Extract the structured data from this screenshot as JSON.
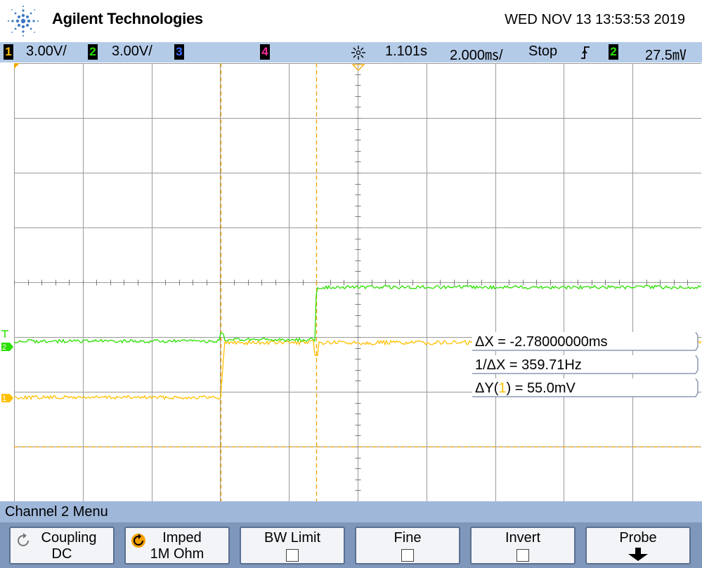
{
  "header": {
    "brand": "Agilent Technologies",
    "datetime": "WED NOV 13 13:53:53 2019"
  },
  "status_bar": {
    "ch1_number": "1",
    "ch1_scale": "3.00V/",
    "ch2_number": "2",
    "ch2_scale": "3.00V/",
    "ch3_number": "3",
    "ch4_number": "4",
    "time_delay": "1.101s",
    "time_scale": "2.000㎳/",
    "run_state": "Stop",
    "trigger_source": "2",
    "trigger_level": "27.5㎷"
  },
  "waveform": {
    "channel1_color": "#ffc000",
    "channel2_color": "#2ae000",
    "channel1_marker": "1",
    "channel2_marker": "2",
    "trigger_marker": "T"
  },
  "measurements": {
    "delta_x": "ΔX = -2.78000000ms",
    "inv_delta_x": "1/ΔX = 359.71Hz",
    "delta_y_prefix": "ΔY(",
    "delta_y_channel": "1",
    "delta_y_suffix": ") = 55.0mV"
  },
  "menu": {
    "title": "Channel 2  Menu",
    "softkeys": [
      {
        "line1": "Coupling",
        "line2": "DC",
        "icon": "rotate-arrow-icon"
      },
      {
        "line1": "Imped",
        "line2": "1M Ohm",
        "icon": "rotate-arrow-icon"
      },
      {
        "line1": "BW Limit",
        "checked": false
      },
      {
        "line1": "Fine",
        "checked": false
      },
      {
        "line1": "Invert",
        "checked": false
      },
      {
        "line1": "Probe",
        "icon": "down-arrow-icon"
      }
    ]
  }
}
